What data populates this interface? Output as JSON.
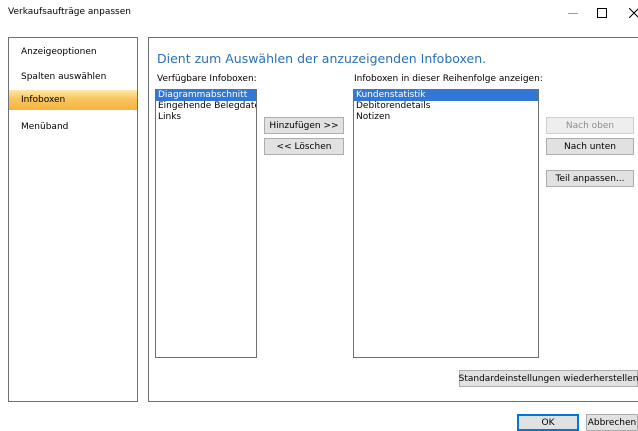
{
  "window": {
    "title": "Verkaufsaufträge anpassen",
    "controls": {
      "minimize_icon": "minimize-icon",
      "maximize_icon": "maximize-icon",
      "close_icon": "close-icon"
    }
  },
  "sidebar": {
    "items": [
      {
        "label": "Anzeigeoptionen",
        "selected": false
      },
      {
        "label": "Spalten auswählen",
        "selected": false
      },
      {
        "label": "Infoboxen",
        "selected": true
      },
      {
        "label": "Menüband",
        "selected": false
      }
    ]
  },
  "main": {
    "heading": "Dient zum Auswählen der anzuzeigenden Infoboxen.",
    "available": {
      "label": "Verfügbare Infoboxen:",
      "items": [
        "Diagrammabschnitt",
        "Eingehende Belegdaten",
        "Links"
      ],
      "selected_index": 0
    },
    "shown": {
      "label": "Infoboxen in dieser Reihenfolge anzeigen:",
      "items": [
        "Kundenstatistik",
        "Debitorendetails",
        "Notizen"
      ],
      "selected_index": 0
    },
    "buttons": {
      "add": "Hinzufügen >>",
      "remove": "<< Löschen",
      "move_up": "Nach oben",
      "move_down": "Nach unten",
      "customize": "Teil anpassen...",
      "restore_defaults": "Standardeinstellungen wiederherstellen"
    }
  },
  "footer": {
    "ok": "OK",
    "cancel": "Abbrechen"
  },
  "colors": {
    "heading": "#2a70b8",
    "selection": "#3077d6",
    "nav_selected": "#f9c55e"
  }
}
